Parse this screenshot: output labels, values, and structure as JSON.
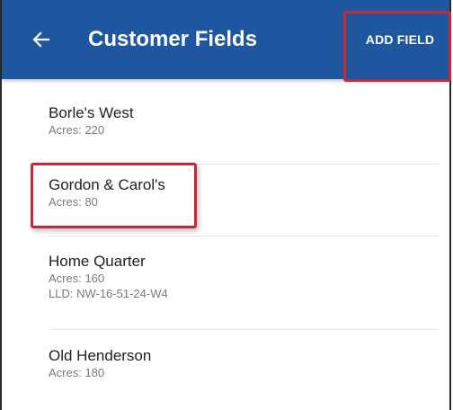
{
  "appbar": {
    "title": "Customer Fields",
    "add_field_label": "ADD FIELD",
    "back_icon": "arrow-left-icon",
    "color": "#1f56a0"
  },
  "fields": [
    {
      "name": "Borle's West",
      "acres": "Acres: 220"
    },
    {
      "name": "Gordon & Carol's",
      "acres": "Acres: 80"
    },
    {
      "name": "Home Quarter",
      "acres": "Acres: 160",
      "lld": "LLD: NW-16-51-24-W4"
    },
    {
      "name": "Old Henderson",
      "acres": "Acres: 180"
    }
  ],
  "highlight_color": "#c42a36"
}
